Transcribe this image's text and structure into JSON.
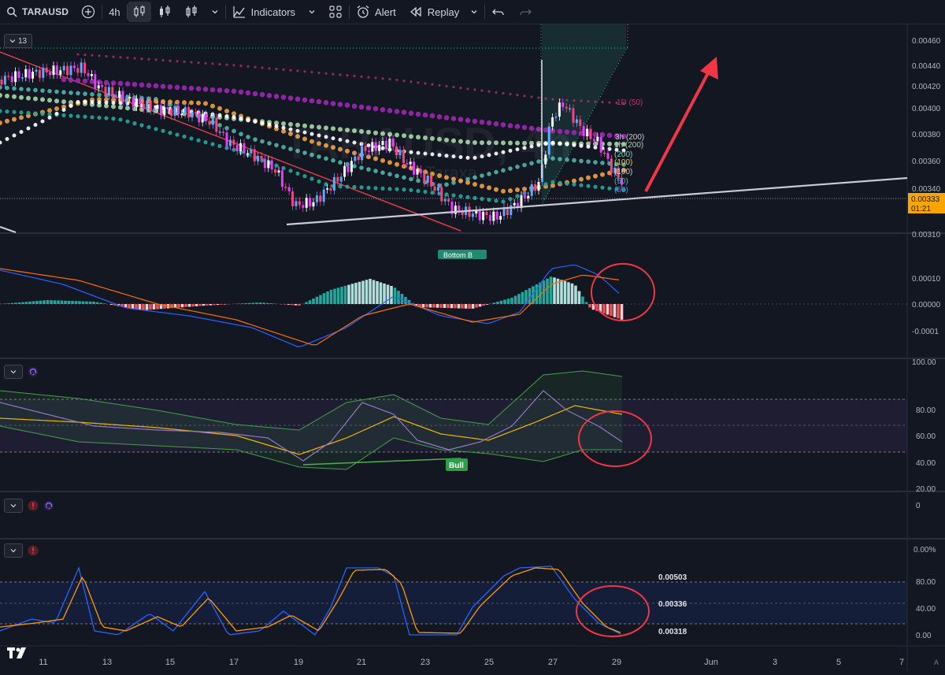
{
  "toolbar": {
    "symbol": "TARAUSD",
    "interval": "4h",
    "indicators_label": "Indicators",
    "alert_label": "Alert",
    "replay_label": "Replay"
  },
  "main_pane": {
    "legend_count": "13",
    "watermark": "TARAUSD, 4h",
    "watermark_sub": "Taraxa",
    "price_axis": [
      "0.00460",
      "0.00440",
      "0.00420",
      "0.00400",
      "0.00380",
      "0.00360",
      "0.00340",
      "0.00310"
    ],
    "current_price": "0.00333",
    "countdown": "01:21",
    "ma_labels": [
      "1D (50)",
      "3h (200)",
      "1h (200)",
      "(200)",
      "(100)",
      "(50)",
      "(50)"
    ],
    "marker_label": "Bottom B"
  },
  "macd_pane": {
    "axis": [
      "0.00010",
      "0.00000",
      "-0.0001"
    ]
  },
  "rsi_pane": {
    "axis": [
      "100.00",
      "80.00",
      "60.00",
      "40.00",
      "20.00"
    ],
    "bull_label": "Bull"
  },
  "empty_pane": {
    "axis": [
      "0"
    ]
  },
  "stoch_pane": {
    "axis": [
      "0.00%",
      "80.00",
      "40.00",
      "0.00"
    ],
    "levels": [
      "0.00503",
      "0.00336",
      "0.00318"
    ]
  },
  "date_axis": [
    "11",
    "13",
    "15",
    "17",
    "19",
    "21",
    "23",
    "25",
    "27",
    "29",
    "Jun",
    "3",
    "5",
    "7"
  ],
  "corner_label": "A",
  "colors": {
    "background": "#131722",
    "up": "#26a69a",
    "down": "#ef5350",
    "annotation": "#f23645",
    "accent": "#2962ff"
  }
}
